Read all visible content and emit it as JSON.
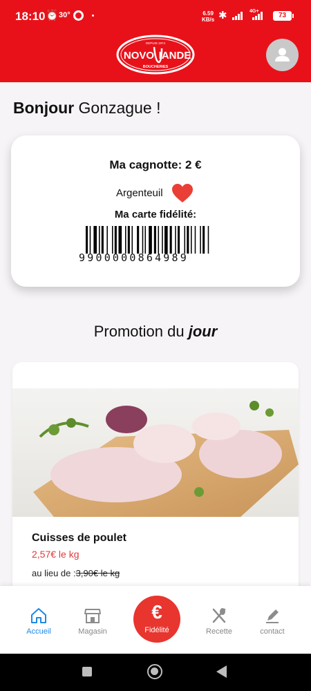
{
  "status_bar": {
    "time": "18:10",
    "temperature": "30°",
    "net_speed_value": "6.59",
    "net_speed_unit": "KB/s",
    "network": "4G+",
    "battery": "73"
  },
  "header": {
    "logo": {
      "top_text": "DEPUIS 1974",
      "left_text": "NOVO",
      "right_text": "IANDE",
      "bottom_text": "BOUCHERIES"
    },
    "avatar_icon": "user-icon"
  },
  "greeting": {
    "hello": "Bonjour",
    "name": "Gonzague !"
  },
  "loyalty_card": {
    "cagnotte": "Ma cagnotte: 2 €",
    "store": "Argenteuil",
    "favorite_icon": "heart-icon",
    "card_label": "Ma carte fidélité:",
    "barcode_number": "9900000864989"
  },
  "promotion": {
    "title_prefix": "Promotion du ",
    "title_em": "jour",
    "product": {
      "name": "Cuisses de poulet",
      "price": "2,57€ le kg",
      "old_prefix": "au lieu de :",
      "old_price": "3,90€ le kg"
    }
  },
  "bottom_nav": {
    "items": [
      {
        "label": "Accueil",
        "icon": "home-icon",
        "active": true
      },
      {
        "label": "Magasin",
        "icon": "store-icon",
        "active": false
      },
      {
        "label": "Fidélité",
        "icon": "euro-icon",
        "active": false
      },
      {
        "label": "Recette",
        "icon": "utensils-icon",
        "active": false
      },
      {
        "label": "contact",
        "icon": "edit-icon",
        "active": false
      }
    ],
    "fab_symbol": "€"
  },
  "colors": {
    "brand_red": "#e8111a",
    "accent_red": "#e8352e",
    "active_blue": "#1e88e5",
    "price_red": "#e03a3a"
  }
}
